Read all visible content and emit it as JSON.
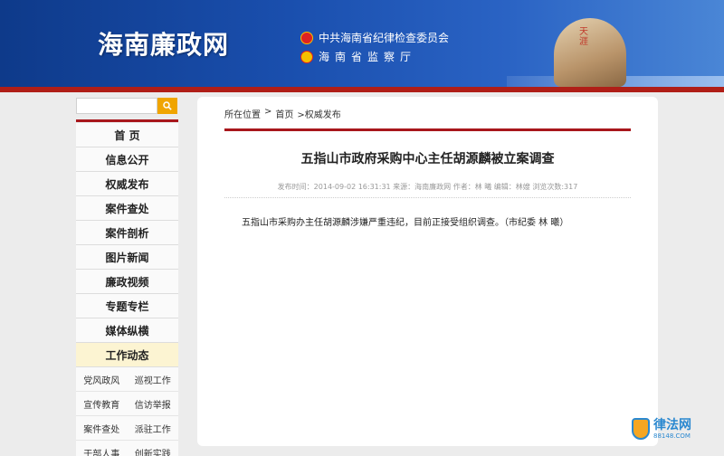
{
  "header": {
    "site_title": "海南廉政网",
    "org_line1": "中共海南省纪律检查委员会",
    "org_line2": "海南省监察厅",
    "rock_text": "天涯"
  },
  "search": {
    "placeholder": ""
  },
  "sidebar": {
    "items": [
      {
        "label": "首 页"
      },
      {
        "label": "信息公开"
      },
      {
        "label": "权威发布"
      },
      {
        "label": "案件查处"
      },
      {
        "label": "案件剖析"
      },
      {
        "label": "图片新闻"
      },
      {
        "label": "廉政视频"
      },
      {
        "label": "专题专栏"
      },
      {
        "label": "媒体纵横"
      },
      {
        "label": "工作动态"
      }
    ],
    "sub_items": [
      [
        "党风政风",
        "巡视工作"
      ],
      [
        "宣传教育",
        "信访举报"
      ],
      [
        "案件查处",
        "派驻工作"
      ],
      [
        "干部人事",
        "创新实践"
      ]
    ]
  },
  "breadcrumb": {
    "prefix": "所在位置",
    "home": "首页",
    "section": ">权威发布"
  },
  "article": {
    "title": "五指山市政府采购中心主任胡源麟被立案调查",
    "meta": "发布时间：2014-09-02 16:31:31 来源：海南廉政网 作者：林 曦 编辑：林嫂 浏览次数:317",
    "body": "五指山市采购办主任胡源麟涉嫌严重违纪，目前正接受组织调查。（市纪委 林 曦）"
  },
  "watermark": {
    "main": "律法网",
    "sub": "88148.COM"
  }
}
